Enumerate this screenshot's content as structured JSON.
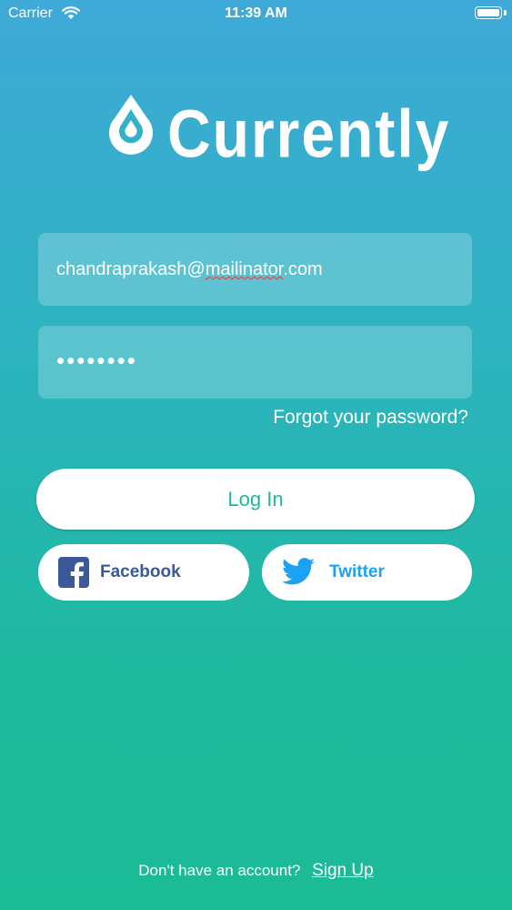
{
  "status_bar": {
    "carrier": "Carrier",
    "time": "11:39 AM"
  },
  "app": {
    "name": "Currently"
  },
  "login_form": {
    "email_value": "chandraprakash@mailinator.com",
    "password_value": "••••••••",
    "forgot_label": "Forgot your password?",
    "login_label": "Log In"
  },
  "social": {
    "facebook_label": "Facebook",
    "twitter_label": "Twitter"
  },
  "signup": {
    "prompt": "Don't have an account?",
    "link_label": "Sign Up"
  },
  "colors": {
    "accent": "#1fb79e",
    "facebook": "#3b5998",
    "twitter": "#1da1f2"
  }
}
